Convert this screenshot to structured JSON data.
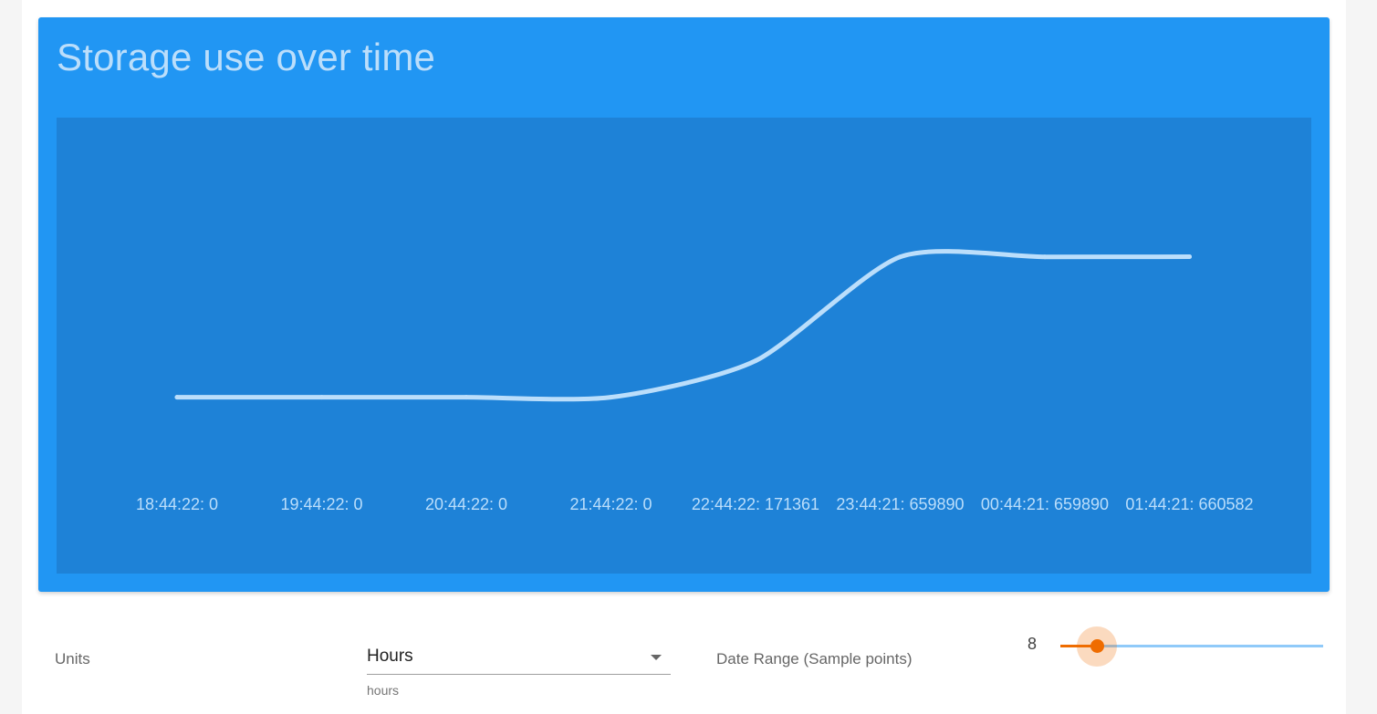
{
  "card": {
    "title": "Storage use over time"
  },
  "chart_data": {
    "type": "line",
    "x": [
      "18:44:22",
      "19:44:22",
      "20:44:22",
      "21:44:22",
      "22:44:22",
      "23:44:21",
      "00:44:21",
      "01:44:21"
    ],
    "series": [
      {
        "values": [
          0,
          0,
          0,
          0,
          171361,
          659890,
          659890,
          660582
        ]
      }
    ],
    "tick_labels": [
      "18:44:22: 0",
      "19:44:22: 0",
      "20:44:22: 0",
      "21:44:22: 0",
      "22:44:22: 171361",
      "23:44:21: 659890",
      "00:44:21: 659890",
      "01:44:21: 660582"
    ],
    "title": "",
    "xlabel": "",
    "ylabel": "",
    "ylim": [
      -100000,
      1100000
    ],
    "grid": false,
    "line_color": "#bbdefb",
    "background_color": "#1e82d7"
  },
  "controls": {
    "units_label": "Units",
    "units_select": {
      "value": "Hours",
      "hint": "hours"
    },
    "range_label": "Date Range (Sample points)",
    "range_slider": {
      "value": "8",
      "fraction": 0.14,
      "accent_color": "#ef6c00",
      "track_color": "#90caf9"
    }
  }
}
